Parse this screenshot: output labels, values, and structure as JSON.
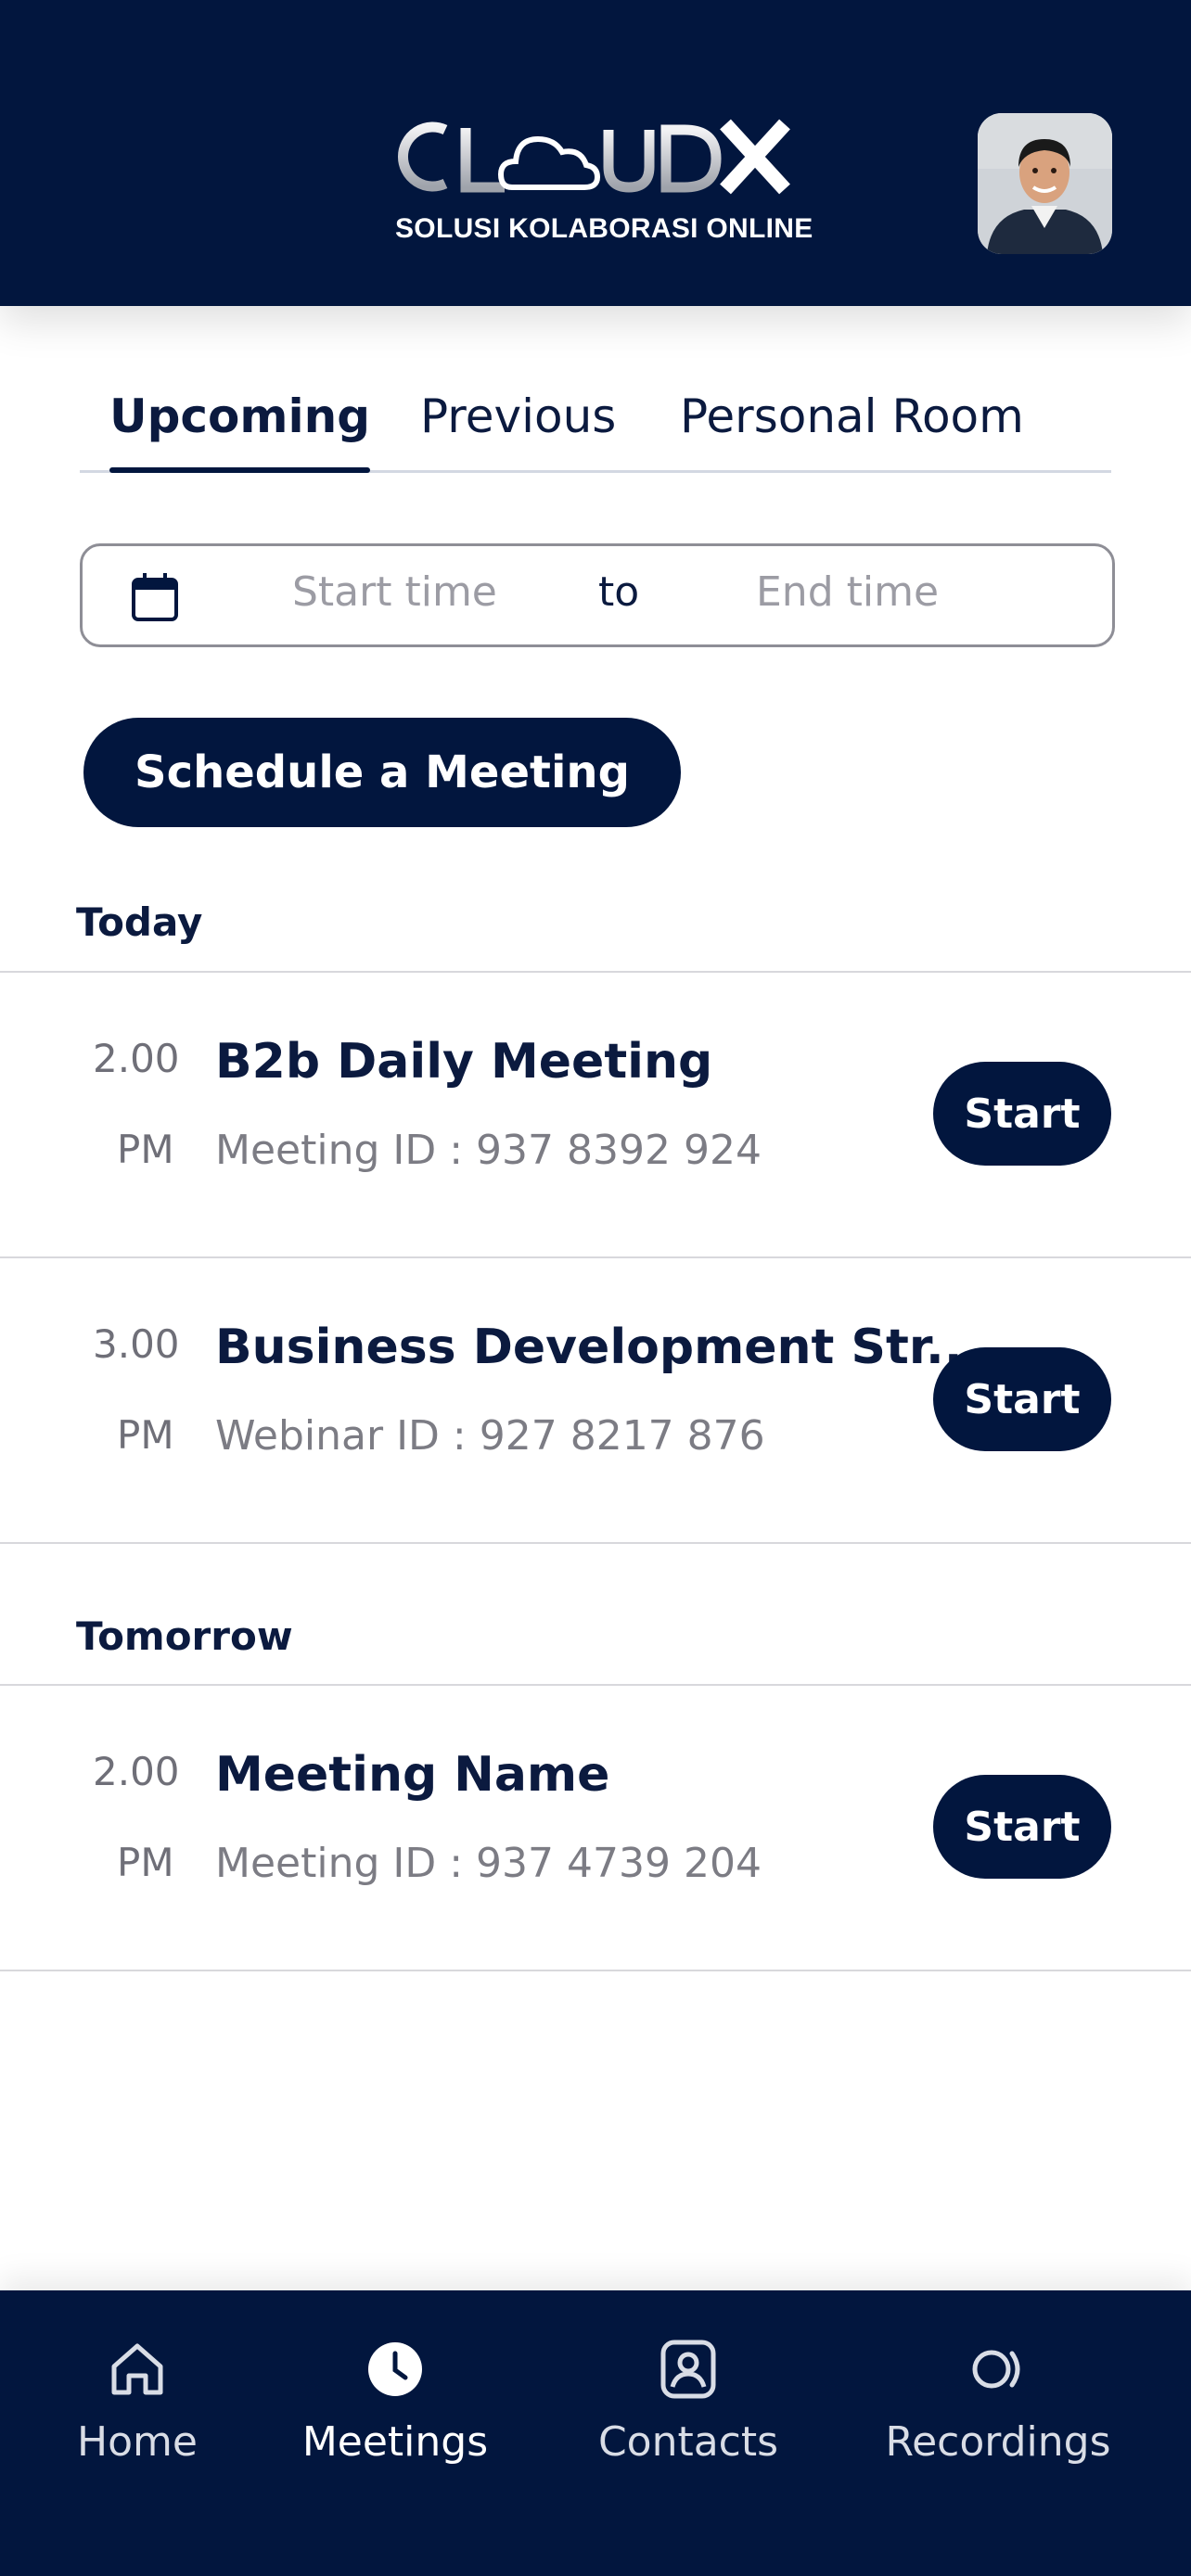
{
  "header": {
    "logo_text": "CLOUDX",
    "tagline": "SOLUSI KOLABORASI ONLINE"
  },
  "tabs": [
    {
      "label": "Upcoming",
      "active": true
    },
    {
      "label": "Previous",
      "active": false
    },
    {
      "label": "Personal Room",
      "active": false
    }
  ],
  "date_range": {
    "start_placeholder": "Start time",
    "separator": "to",
    "end_placeholder": "End time"
  },
  "schedule_button": "Schedule a Meeting",
  "sections": [
    {
      "label": "Today",
      "meetings": [
        {
          "time": "2.00",
          "period": "PM",
          "title": "B2b Daily Meeting",
          "id_text": "Meeting ID : 937 8392 924",
          "action": "Start"
        },
        {
          "time": "3.00",
          "period": "PM",
          "title": "Business Development Str...",
          "id_text": "Webinar ID : 927 8217 876",
          "action": "Start"
        }
      ]
    },
    {
      "label": "Tomorrow",
      "meetings": [
        {
          "time": "2.00",
          "period": "PM",
          "title": "Meeting Name",
          "id_text": "Meeting ID : 937 4739 204",
          "action": "Start"
        }
      ]
    }
  ],
  "bottom_nav": [
    {
      "label": "Home",
      "icon": "home-icon",
      "active": false
    },
    {
      "label": "Meetings",
      "icon": "clock-icon",
      "active": true
    },
    {
      "label": "Contacts",
      "icon": "contact-icon",
      "active": false
    },
    {
      "label": "Recordings",
      "icon": "recording-icon",
      "active": false
    }
  ],
  "colors": {
    "primary_navy": "#02163e",
    "text_dark": "#0b1a3f",
    "text_muted": "#7c7c84",
    "divider": "#d8d8dc"
  }
}
